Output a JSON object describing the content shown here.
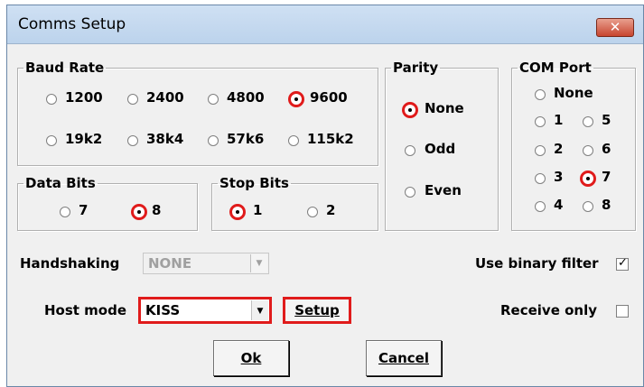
{
  "window": {
    "title": "Comms Setup",
    "close_label": "✕"
  },
  "baud": {
    "legend": "Baud Rate",
    "options": [
      "1200",
      "2400",
      "4800",
      "9600",
      "19k2",
      "38k4",
      "57k6",
      "115k2"
    ],
    "selected": "9600"
  },
  "parity": {
    "legend": "Parity",
    "options": [
      "None",
      "Odd",
      "Even"
    ],
    "selected": "None"
  },
  "com": {
    "legend": "COM Port",
    "options": [
      "None",
      "1",
      "5",
      "2",
      "6",
      "3",
      "7",
      "4",
      "8"
    ],
    "selected": "7"
  },
  "databits": {
    "legend": "Data Bits",
    "options": [
      "7",
      "8"
    ],
    "selected": "8"
  },
  "stopbits": {
    "legend": "Stop Bits",
    "options": [
      "1",
      "2"
    ],
    "selected": "1"
  },
  "handshaking": {
    "label": "Handshaking",
    "value": "NONE"
  },
  "hostmode": {
    "label": "Host mode",
    "value": "KISS",
    "setup_label": "Setup"
  },
  "binary_filter": {
    "label": "Use binary filter",
    "checked": true
  },
  "receive_only": {
    "label": "Receive only",
    "checked": false
  },
  "buttons": {
    "ok": "Ok",
    "cancel": "Cancel"
  },
  "colors": {
    "highlight": "#e01b1b",
    "title_bg": "#c6daf0",
    "close_bg": "#c7452f"
  }
}
